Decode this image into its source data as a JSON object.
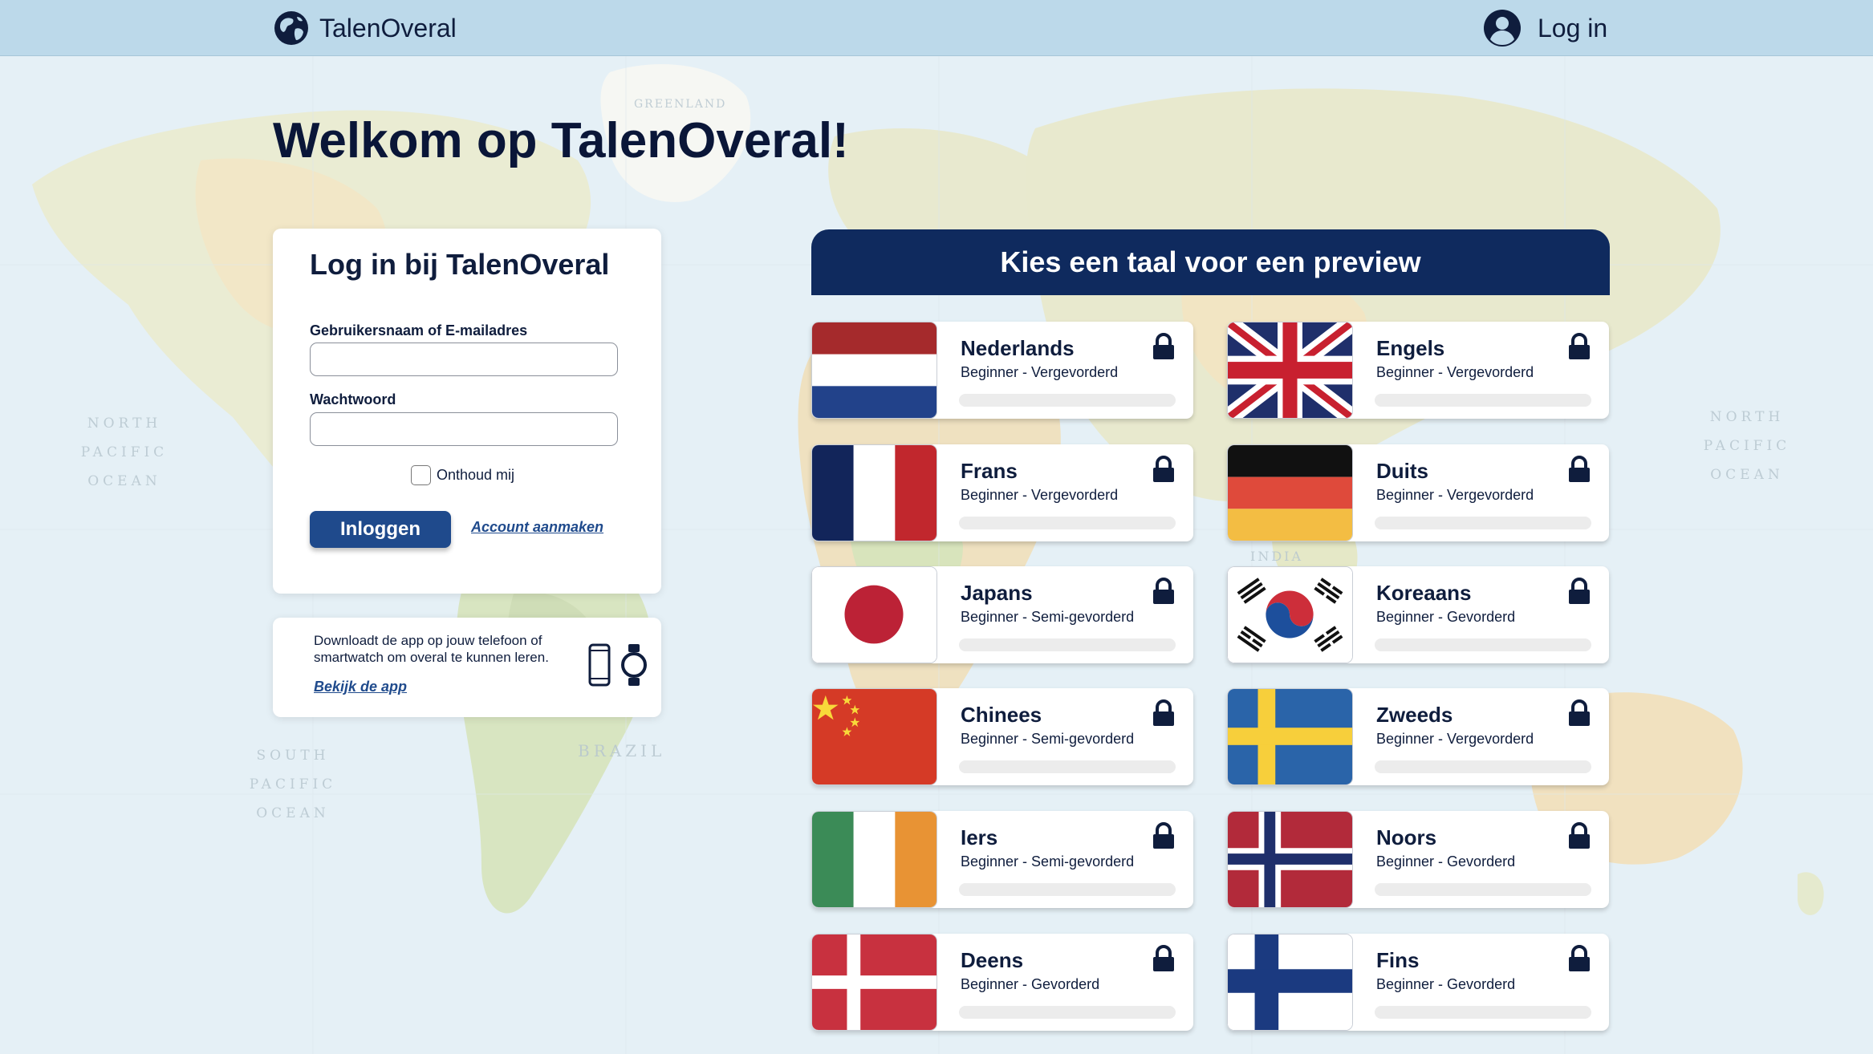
{
  "header": {
    "brand_name": "TalenOveral",
    "login_label": "Log in"
  },
  "page": {
    "headline": "Welkom op TalenOveral!"
  },
  "map_labels": {
    "greenland": "GREENLAND",
    "north_pacific_left": "NORTH PACIFIC OCEAN",
    "north_pacific_right": "NORTH PACIFIC OCEAN",
    "south_pacific": "SOUTH PACIFIC OCEAN",
    "brazil": "BRAZIL",
    "india": "INDIA"
  },
  "login": {
    "title": "Log in bij TalenOveral",
    "username_label": "Gebruikersnaam of E-mailadres",
    "username_value": "",
    "password_label": "Wachtwoord",
    "password_value": "",
    "remember_label": "Onthoud mij",
    "submit_label": "Inloggen",
    "register_label": "Account aanmaken"
  },
  "app_promo": {
    "text": "Downloadt de app op jouw telefoon of smartwatch om overal te kunnen leren.",
    "link_label": "Bekijk de app"
  },
  "languages": {
    "header": "Kies een taal voor een preview",
    "items": [
      {
        "name": "Nederlands",
        "level": "Beginner - Vergevorderd",
        "flag": "netherlands-flag-icon",
        "locked": true
      },
      {
        "name": "Engels",
        "level": "Beginner - Vergevorderd",
        "flag": "uk-flag-icon",
        "locked": true
      },
      {
        "name": "Frans",
        "level": "Beginner - Vergevorderd",
        "flag": "france-flag-icon",
        "locked": true
      },
      {
        "name": "Duits",
        "level": "Beginner - Vergevorderd",
        "flag": "germany-flag-icon",
        "locked": true
      },
      {
        "name": "Japans",
        "level": "Beginner - Semi-gevorderd",
        "flag": "japan-flag-icon",
        "locked": true
      },
      {
        "name": "Koreaans",
        "level": "Beginner - Gevorderd",
        "flag": "korea-flag-icon",
        "locked": true
      },
      {
        "name": "Chinees",
        "level": "Beginner - Semi-gevorderd",
        "flag": "china-flag-icon",
        "locked": true
      },
      {
        "name": "Zweeds",
        "level": "Beginner - Vergevorderd",
        "flag": "sweden-flag-icon",
        "locked": true
      },
      {
        "name": "Iers",
        "level": "Beginner - Semi-gevorderd",
        "flag": "ireland-flag-icon",
        "locked": true
      },
      {
        "name": "Noors",
        "level": "Beginner - Gevorderd",
        "flag": "norway-flag-icon",
        "locked": true
      },
      {
        "name": "Deens",
        "level": "Beginner - Gevorderd",
        "flag": "denmark-flag-icon",
        "locked": true
      },
      {
        "name": "Fins",
        "level": "Beginner - Gevorderd",
        "flag": "finland-flag-icon",
        "locked": true
      }
    ]
  },
  "colors": {
    "navy": "#0f2a5e",
    "primary_button": "#1f4a8c",
    "topbar": "#bcd9ea",
    "text": "#0f1d3d"
  }
}
